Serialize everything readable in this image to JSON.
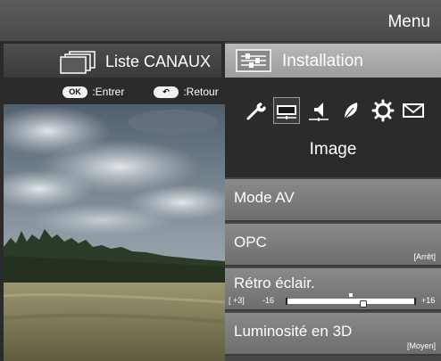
{
  "header": {
    "title": "Menu"
  },
  "left_panel": {
    "tab_label": "Liste CANAUX",
    "icon": "channel-list-icon",
    "hints": [
      {
        "button": "OK",
        "label": ":Entrer"
      },
      {
        "button": "↶",
        "label": ":Retour"
      }
    ],
    "preview_image": "landscape-photo"
  },
  "right_panel": {
    "tab_label": "Installation",
    "icon": "installation-icon",
    "category_icons": [
      "wrench-icon",
      "picture-icon",
      "speaker-icon",
      "leaf-icon",
      "gear-icon",
      "envelope-icon"
    ],
    "selected_category_index": 1,
    "category_title": "Image",
    "items": [
      {
        "label": "Mode AV",
        "value": ""
      },
      {
        "label": "OPC",
        "value": "[Arrêt]"
      },
      {
        "label": "Rétro éclair.",
        "slider": {
          "current_text": "[ +3]",
          "min_label": "-16",
          "max_label": "+16",
          "min": -16,
          "max": 16,
          "value": 3,
          "default_value": 0
        }
      },
      {
        "label": "Luminosité en 3D",
        "value": "[Moyen]"
      }
    ]
  },
  "colors": {
    "header_bg": "#555555",
    "selected_tab_bg": "#aaaaaa",
    "menu_item_bg": "#7c7c7c",
    "panel_bg": "#2b2b2b"
  }
}
